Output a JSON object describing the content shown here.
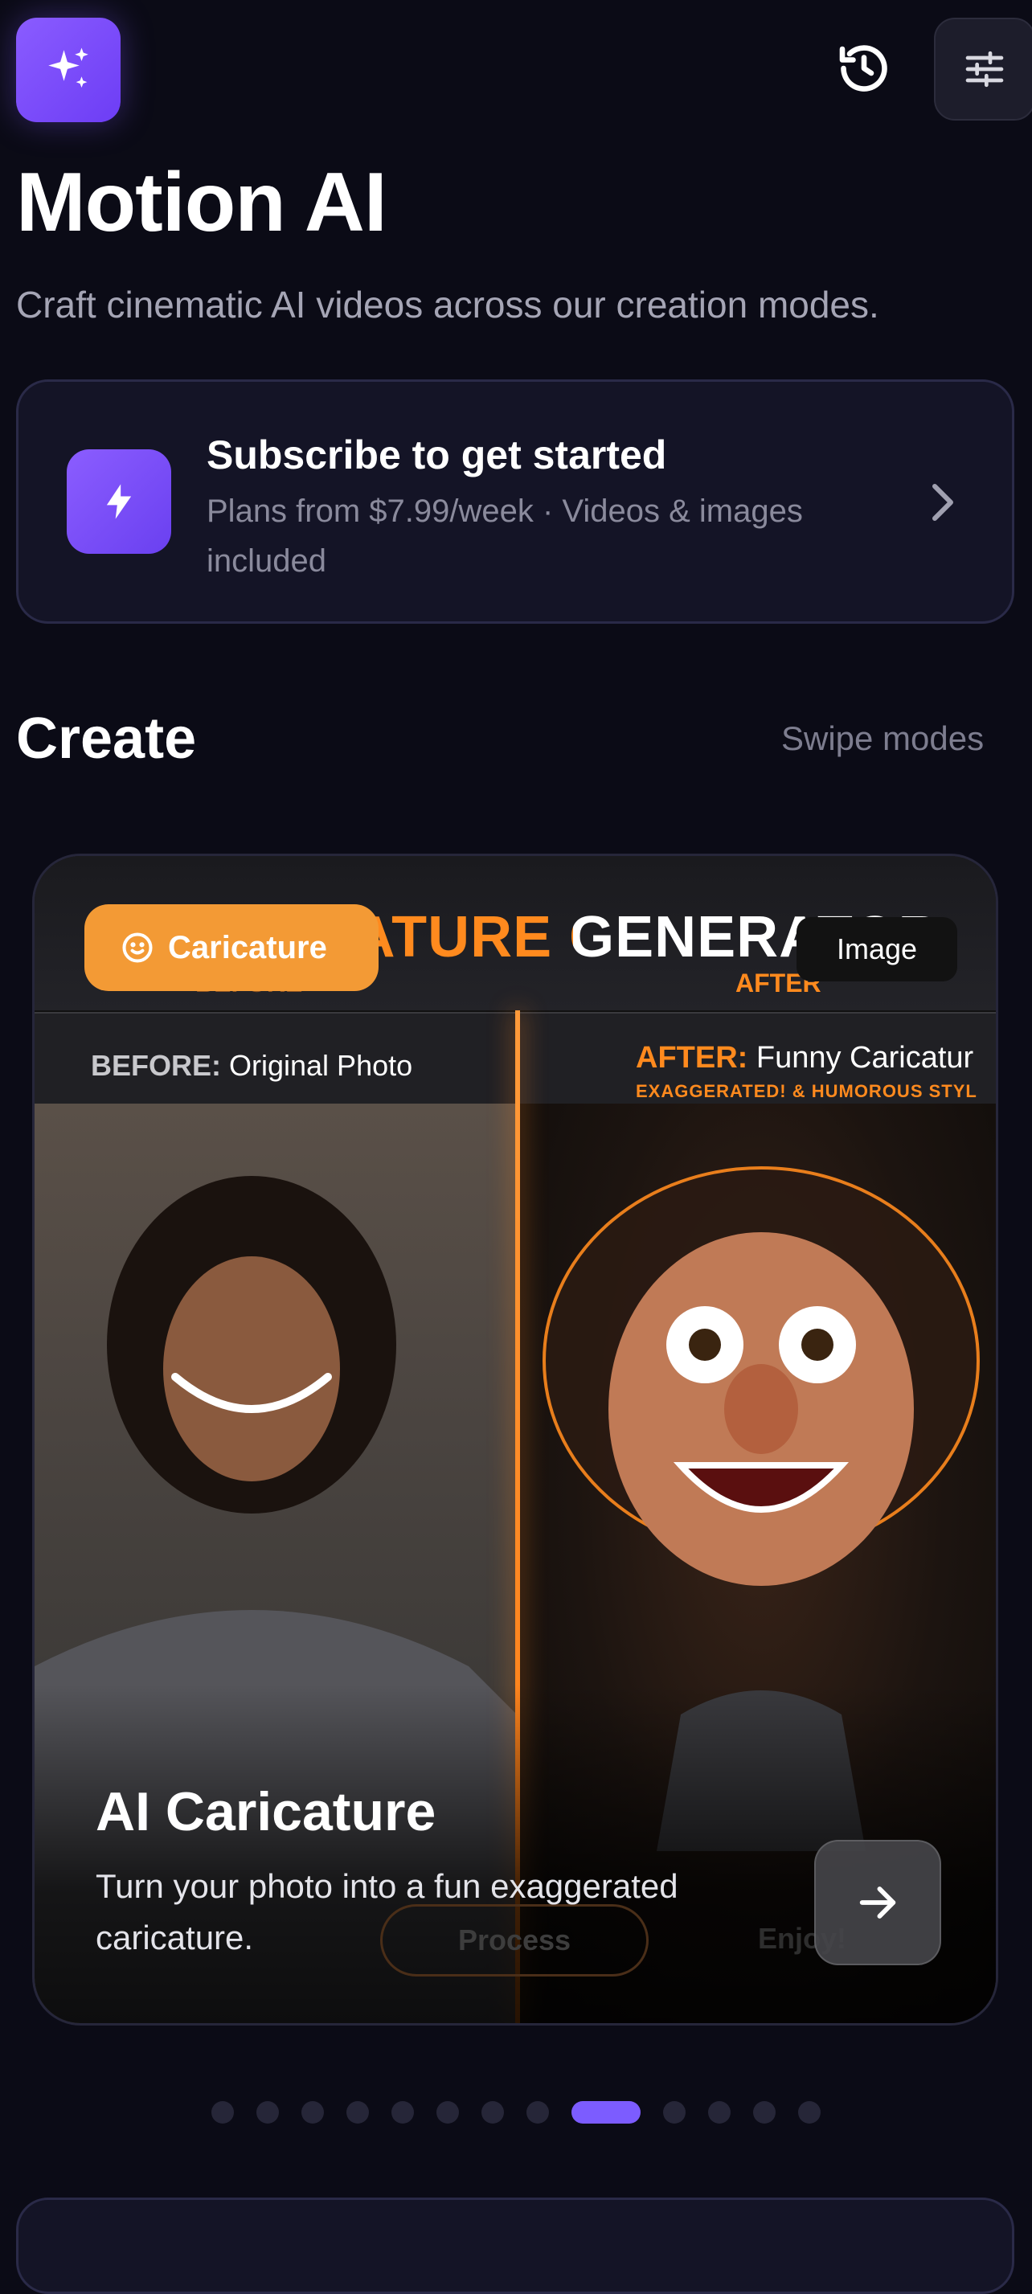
{
  "header": {
    "app_icon": "sparkles-icon",
    "history_icon": "history-icon",
    "filter_icon": "sliders-icon"
  },
  "title": "Motion AI",
  "subtitle": "Craft cinematic AI videos across our creation modes.",
  "subscribe": {
    "title": "Subscribe to get started",
    "text": "Plans from $7.99/week · Videos & images included",
    "icon": "lightning-icon"
  },
  "create": {
    "heading": "Create",
    "hint": "Swipe modes"
  },
  "hero": {
    "banner_title": "AI CARICATURE GENERATOR",
    "before_tag": "BEFORE",
    "after_tag": "AFTER",
    "mode_pill": "Caricature",
    "image_pill": "Image",
    "before_label_bold": "BEFORE:",
    "before_label_text": " Original Photo",
    "after_label_bold": "AFTER:",
    "after_label_text": " Funny Caricatur",
    "after_sub": "EXAGGERATED! & HUMOROUS STYL",
    "step_process": "Process",
    "step_enjoy": "Enjoy!",
    "card_title": "AI Caricature",
    "card_desc": "Turn your photo into a fun exaggerated caricature."
  },
  "pagination": {
    "count": 13,
    "active_index": 8
  },
  "colors": {
    "accent": "#7c5cff",
    "orange": "#ff8a1e",
    "background": "#0b0b16"
  }
}
